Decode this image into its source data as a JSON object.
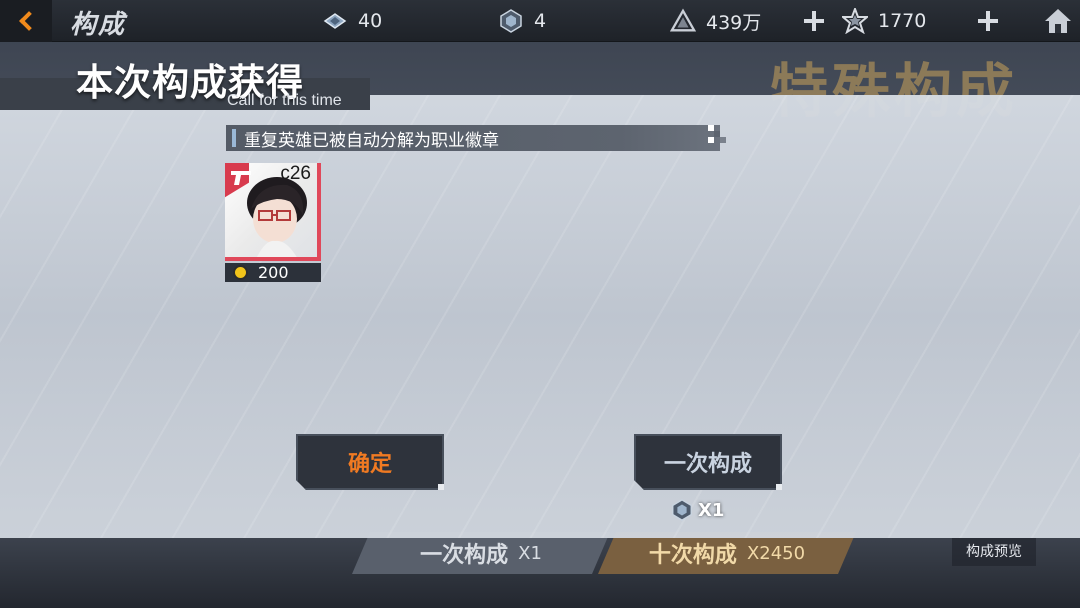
{
  "topbar": {
    "title": "构成",
    "resources": {
      "crystal": "40",
      "ticket": "4",
      "gold": "439万",
      "star": "1770"
    }
  },
  "background": {
    "event_title": "特殊构成",
    "once_label": "一次构成",
    "once_cost": "X1",
    "ten_label": "十次构成",
    "ten_cost": "X2450",
    "preview_label": "构成预览"
  },
  "dialog": {
    "title": "本次构成获得",
    "subtitle": "Call for this time",
    "notice": "重复英雄已被自动分解为职业徽章",
    "reward": {
      "level": "c26",
      "badge_count": "200",
      "badge_icon": "class-badge-icon"
    },
    "confirm_label": "确定",
    "again_label": "一次构成",
    "again_cost": "X1"
  },
  "colors": {
    "accent_orange": "#f07a22",
    "card_red": "#e0485a",
    "dialog_bg": "#d2d8e0"
  }
}
